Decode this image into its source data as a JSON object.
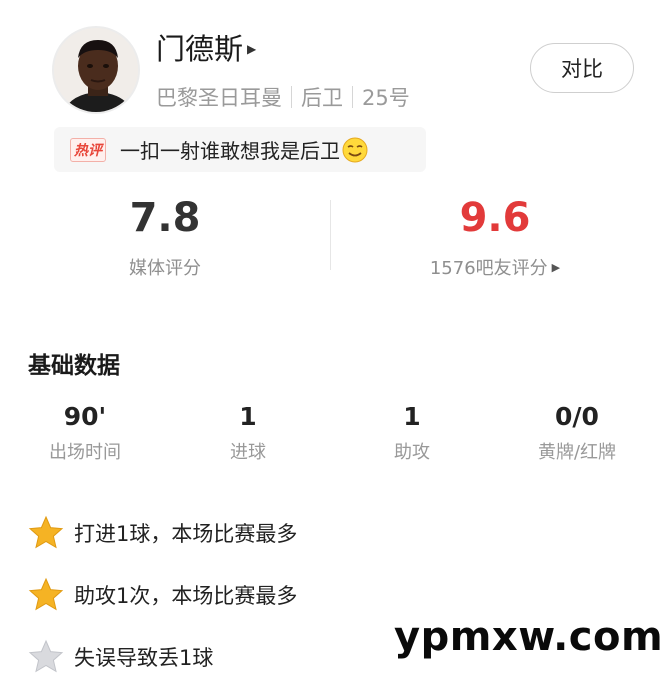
{
  "player": {
    "name": "门德斯",
    "club": "巴黎圣日耳曼",
    "position": "后卫",
    "number": "25号",
    "avatar_icon": "player-photo"
  },
  "compare_button": "对比",
  "hot_comment": {
    "tag": "热评",
    "text": "一扣一射谁敢想我是后卫"
  },
  "scores": {
    "media": {
      "value": "7.8",
      "label": "媒体评分"
    },
    "fans": {
      "value": "9.6",
      "label": "1576吧友评分",
      "color": "#e23a3a"
    }
  },
  "basic_data": {
    "title": "基础数据",
    "stats": [
      {
        "value": "90'",
        "label": "出场时间"
      },
      {
        "value": "1",
        "label": "进球"
      },
      {
        "value": "1",
        "label": "助攻"
      },
      {
        "value": "0/0",
        "label": "黄牌/红牌"
      }
    ]
  },
  "highlights": [
    {
      "icon": "gold-star",
      "text": "打进1球，本场比赛最多"
    },
    {
      "icon": "gold-star",
      "text": "助攻1次，本场比赛最多"
    },
    {
      "icon": "grey-star",
      "text": "失误导致丢1球"
    }
  ],
  "watermark": "ypmxw.com"
}
